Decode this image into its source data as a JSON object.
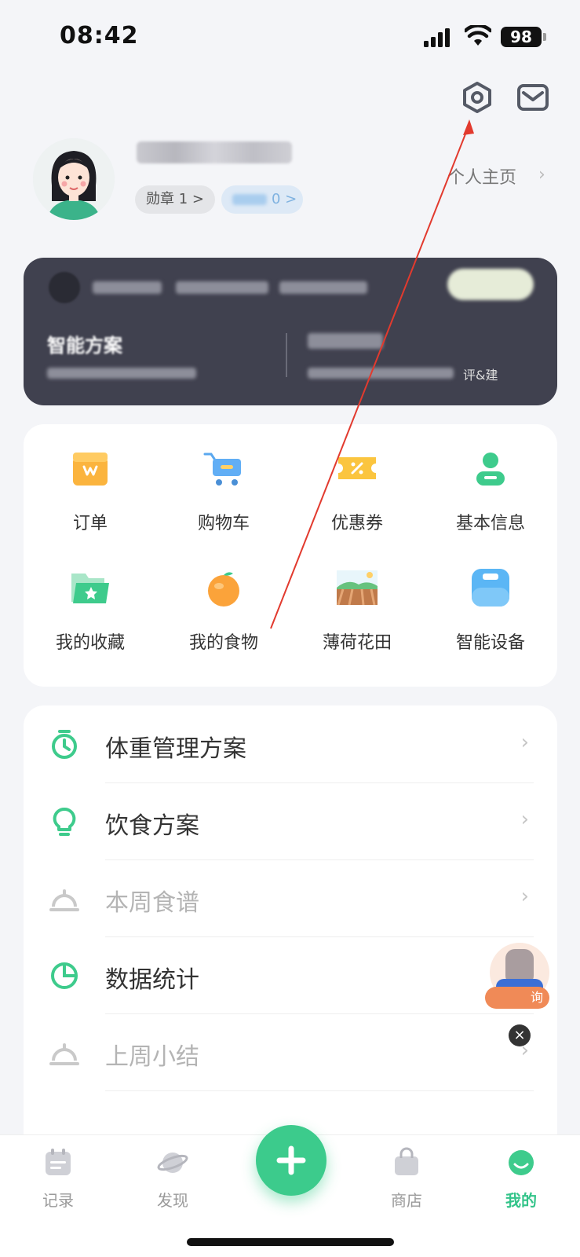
{
  "status": {
    "time": "08:42",
    "battery": "98"
  },
  "profile": {
    "badge_label": "勋章 1 >",
    "points_label": "0 >",
    "homepage_label": "个人主页",
    "homepage_chevron": "›"
  },
  "member_card": {
    "plan_title": "智能方案",
    "evaluation_text": "评&建"
  },
  "grid": {
    "items": [
      {
        "label": "订单",
        "icon": "order-box-icon"
      },
      {
        "label": "购物车",
        "icon": "shopping-cart-icon"
      },
      {
        "label": "优惠券",
        "icon": "coupon-icon"
      },
      {
        "label": "基本信息",
        "icon": "person-info-icon"
      },
      {
        "label": "我的收藏",
        "icon": "favorite-folder-icon"
      },
      {
        "label": "我的食物",
        "icon": "orange-food-icon"
      },
      {
        "label": "薄荷花田",
        "icon": "farm-field-icon"
      },
      {
        "label": "智能设备",
        "icon": "smart-scale-icon"
      }
    ]
  },
  "list": {
    "items": [
      {
        "label": "体重管理方案",
        "icon": "timer-icon",
        "chevron": "›"
      },
      {
        "label": "饮食方案",
        "icon": "lightbulb-icon",
        "chevron": "›"
      },
      {
        "label": "本周食谱",
        "icon": "service-bell-icon",
        "chevron": "›"
      },
      {
        "label": "数据统计",
        "icon": "pie-chart-icon",
        "chevron": "›"
      },
      {
        "label": "上周小结",
        "icon": "service-bell-icon",
        "chevron": "›"
      }
    ]
  },
  "assistant": {
    "label": "询",
    "close": "×"
  },
  "tabbar": {
    "items": [
      {
        "label": "记录",
        "icon": "calendar-icon"
      },
      {
        "label": "发现",
        "icon": "planet-icon"
      },
      {
        "label": "商店",
        "icon": "shopping-bag-icon"
      },
      {
        "label": "我的",
        "icon": "profile-face-icon"
      }
    ],
    "plus": "+"
  },
  "colors": {
    "accent": "#34c48a",
    "card_dark": "#40414f",
    "page_bg": "#f4f5f8"
  }
}
